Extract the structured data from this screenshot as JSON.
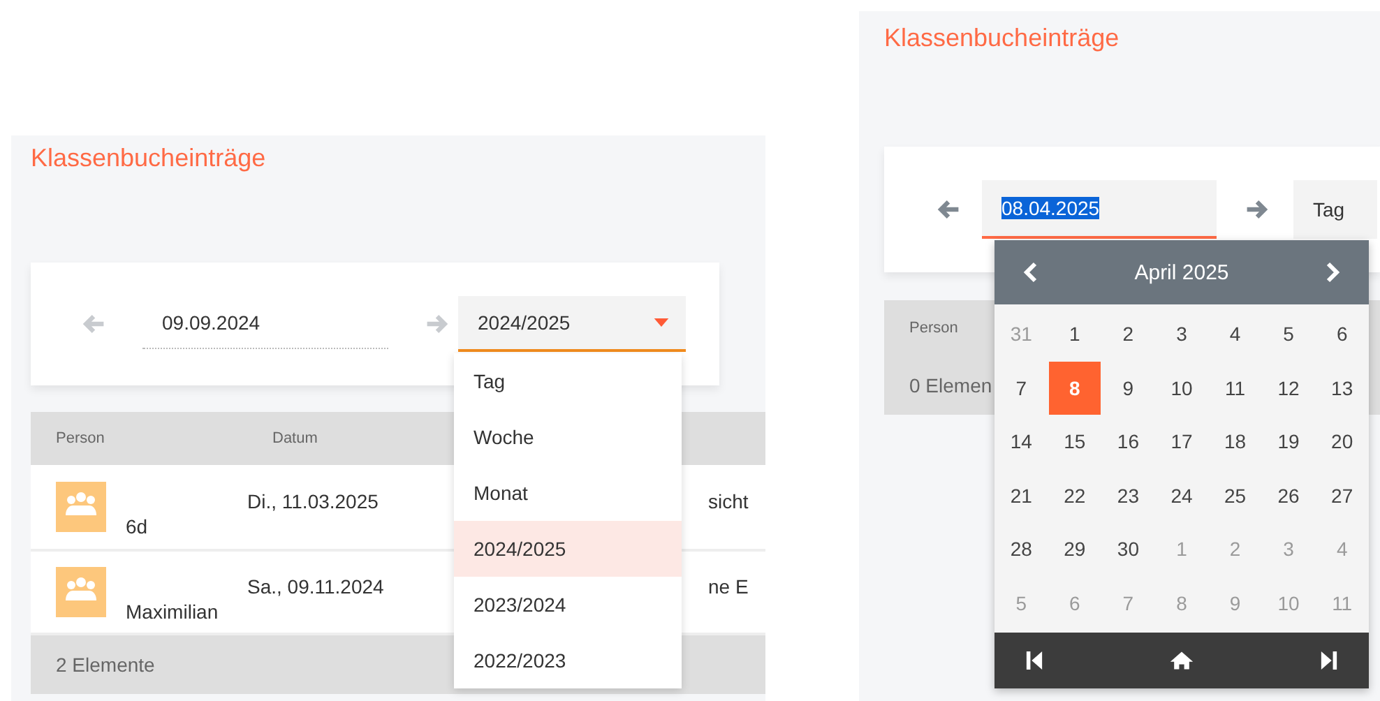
{
  "left_view": {
    "title": "Klassenbucheinträge",
    "date_field": {
      "value": "09.09.2024"
    },
    "period_select": {
      "value": "2024/2025",
      "options": [
        {
          "label": "Tag",
          "selected": false
        },
        {
          "label": "Woche",
          "selected": false
        },
        {
          "label": "Monat",
          "selected": false
        },
        {
          "label": "2024/2025",
          "selected": true
        },
        {
          "label": "2023/2024",
          "selected": false
        },
        {
          "label": "2022/2023",
          "selected": false
        }
      ]
    },
    "table": {
      "columns": [
        "Person",
        "Datum"
      ],
      "rows": [
        {
          "person": "6d",
          "date": "Di., 11.03.2025",
          "column_3": "sicht"
        },
        {
          "person": "Maximilian",
          "date": "Sa., 09.11.2024",
          "column_3": "ne E"
        }
      ],
      "footer": "2 Elemente"
    }
  },
  "right_view": {
    "title": "Klassenbucheinträge",
    "date_field": {
      "value": "08.04.2025",
      "text_highlighted": true
    },
    "period_select": {
      "value": "Tag"
    },
    "table": {
      "columns": [
        "Person"
      ],
      "footer": "0 Elemen"
    },
    "datepicker": {
      "month": "April 2025",
      "days": [
        {
          "label": "31",
          "outside": true,
          "selected": false
        },
        {
          "label": "1",
          "outside": false,
          "selected": false
        },
        {
          "label": "2",
          "outside": false,
          "selected": false
        },
        {
          "label": "3",
          "outside": false,
          "selected": false
        },
        {
          "label": "4",
          "outside": false,
          "selected": false
        },
        {
          "label": "5",
          "outside": false,
          "selected": false
        },
        {
          "label": "6",
          "outside": false,
          "selected": false
        },
        {
          "label": "7",
          "outside": false,
          "selected": false
        },
        {
          "label": "8",
          "outside": false,
          "selected": true
        },
        {
          "label": "9",
          "outside": false,
          "selected": false
        },
        {
          "label": "10",
          "outside": false,
          "selected": false
        },
        {
          "label": "11",
          "outside": false,
          "selected": false
        },
        {
          "label": "12",
          "outside": false,
          "selected": false
        },
        {
          "label": "13",
          "outside": false,
          "selected": false
        },
        {
          "label": "14",
          "outside": false,
          "selected": false
        },
        {
          "label": "15",
          "outside": false,
          "selected": false
        },
        {
          "label": "16",
          "outside": false,
          "selected": false
        },
        {
          "label": "17",
          "outside": false,
          "selected": false
        },
        {
          "label": "18",
          "outside": false,
          "selected": false
        },
        {
          "label": "19",
          "outside": false,
          "selected": false
        },
        {
          "label": "20",
          "outside": false,
          "selected": false
        },
        {
          "label": "21",
          "outside": false,
          "selected": false
        },
        {
          "label": "22",
          "outside": false,
          "selected": false
        },
        {
          "label": "23",
          "outside": false,
          "selected": false
        },
        {
          "label": "24",
          "outside": false,
          "selected": false
        },
        {
          "label": "25",
          "outside": false,
          "selected": false
        },
        {
          "label": "26",
          "outside": false,
          "selected": false
        },
        {
          "label": "27",
          "outside": false,
          "selected": false
        },
        {
          "label": "28",
          "outside": false,
          "selected": false
        },
        {
          "label": "29",
          "outside": false,
          "selected": false
        },
        {
          "label": "30",
          "outside": false,
          "selected": false
        },
        {
          "label": "1",
          "outside": true,
          "selected": false
        },
        {
          "label": "2",
          "outside": true,
          "selected": false
        },
        {
          "label": "3",
          "outside": true,
          "selected": false
        },
        {
          "label": "4",
          "outside": true,
          "selected": false
        },
        {
          "label": "5",
          "outside": true,
          "selected": false
        },
        {
          "label": "6",
          "outside": true,
          "selected": false
        },
        {
          "label": "7",
          "outside": true,
          "selected": false
        },
        {
          "label": "8",
          "outside": true,
          "selected": false
        },
        {
          "label": "9",
          "outside": true,
          "selected": false
        },
        {
          "label": "10",
          "outside": true,
          "selected": false
        },
        {
          "label": "11",
          "outside": true,
          "selected": false
        }
      ]
    }
  }
}
